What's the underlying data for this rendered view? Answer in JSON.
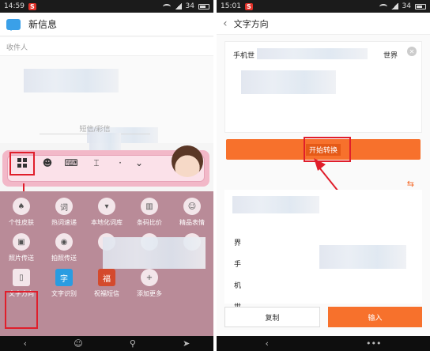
{
  "left": {
    "status": {
      "time": "14:59",
      "badge": "S",
      "battery": "34"
    },
    "header_title": "新信息",
    "recipient_label": "收件人",
    "sms_placeholder": "短信/彩信",
    "panel_items": [
      {
        "label": "个性皮肤",
        "icon": "shirt-icon",
        "glyph": "♠"
      },
      {
        "label": "热词速递",
        "icon": "hotword-icon",
        "glyph": "词"
      },
      {
        "label": "本地化词库",
        "icon": "dictionary-icon",
        "glyph": "▾"
      },
      {
        "label": "条码比价",
        "icon": "barcode-icon",
        "glyph": "▥"
      },
      {
        "label": "精品表情",
        "icon": "emoji-store-icon",
        "glyph": "☺"
      },
      {
        "label": "照片传送",
        "icon": "photo-icon",
        "glyph": "▣"
      },
      {
        "label": "拍照传送",
        "icon": "camera-icon",
        "glyph": "◉"
      },
      {
        "label": "",
        "icon": "blurred-icon",
        "glyph": ""
      },
      {
        "label": "",
        "icon": "blurred-icon",
        "glyph": ""
      },
      {
        "label": "",
        "icon": "blurred-icon",
        "glyph": ""
      },
      {
        "label": "文字方向",
        "icon": "text-direction-icon",
        "glyph": "▯"
      },
      {
        "label": "文字识别",
        "icon": "ocr-icon",
        "glyph": "字"
      },
      {
        "label": "祝福短信",
        "icon": "blessing-sms-icon",
        "glyph": "福"
      },
      {
        "label": "添加更多",
        "icon": "add-more-icon",
        "glyph": "+"
      }
    ]
  },
  "right": {
    "status": {
      "time": "15:01",
      "badge": "S",
      "battery": "34"
    },
    "header_title": "文字方向",
    "input_text_start": "手机世",
    "input_text_end": "世界",
    "convert_label": "开始转换",
    "output_chars": [
      "界",
      "手",
      "机",
      "世"
    ],
    "copy_label": "复制",
    "insert_label": "输入"
  }
}
